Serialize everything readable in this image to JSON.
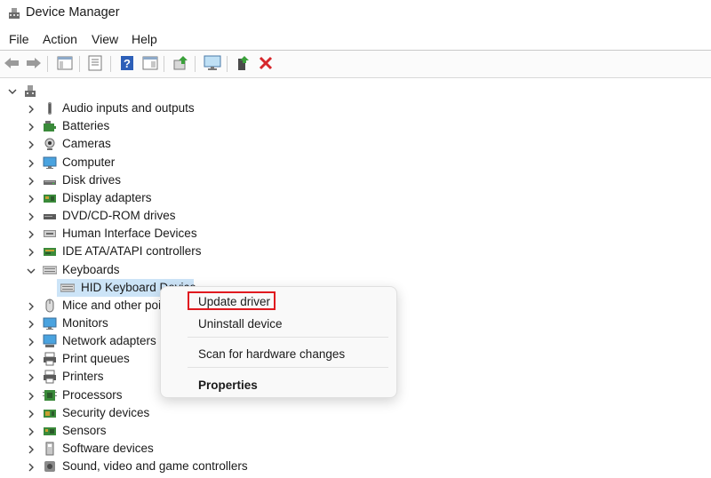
{
  "window": {
    "title": "Device Manager"
  },
  "menu": [
    "File",
    "Action",
    "View",
    "Help"
  ],
  "toolbar": [
    "back-icon",
    "forward-icon",
    "show-hide-console-tree-icon",
    "properties-icon",
    "help-icon",
    "view-icon",
    "update-driver-icon",
    "scan-hardware-icon",
    "enable-device-icon",
    "uninstall-device-icon"
  ],
  "tree": {
    "root": {
      "expanded": true
    },
    "categories": [
      {
        "label": "Audio inputs and outputs",
        "icon": "speaker-icon",
        "expanded": false
      },
      {
        "label": "Batteries",
        "icon": "battery-icon",
        "expanded": false
      },
      {
        "label": "Cameras",
        "icon": "camera-icon",
        "expanded": false
      },
      {
        "label": "Computer",
        "icon": "computer-icon",
        "expanded": false
      },
      {
        "label": "Disk drives",
        "icon": "disk-drive-icon",
        "expanded": false
      },
      {
        "label": "Display adapters",
        "icon": "display-adapter-icon",
        "expanded": false
      },
      {
        "label": "DVD/CD-ROM drives",
        "icon": "dvd-drive-icon",
        "expanded": false
      },
      {
        "label": "Human Interface Devices",
        "icon": "hid-icon",
        "expanded": false
      },
      {
        "label": "IDE ATA/ATAPI controllers",
        "icon": "ide-controller-icon",
        "expanded": false
      },
      {
        "label": "Keyboards",
        "icon": "keyboard-icon",
        "expanded": true
      },
      {
        "label": "HID Keyboard Device",
        "icon": "keyboard-icon",
        "child": true,
        "selected": true
      },
      {
        "label": "Mice and other pointing devices",
        "icon": "mouse-icon",
        "expanded": false
      },
      {
        "label": "Monitors",
        "icon": "monitor-icon",
        "expanded": false
      },
      {
        "label": "Network adapters",
        "icon": "network-adapter-icon",
        "expanded": false
      },
      {
        "label": "Print queues",
        "icon": "print-queue-icon",
        "expanded": false
      },
      {
        "label": "Printers",
        "icon": "printer-icon",
        "expanded": false
      },
      {
        "label": "Processors",
        "icon": "processor-icon",
        "expanded": false
      },
      {
        "label": "Security devices",
        "icon": "security-device-icon",
        "expanded": false
      },
      {
        "label": "Sensors",
        "icon": "sensor-icon",
        "expanded": false
      },
      {
        "label": "Software devices",
        "icon": "software-device-icon",
        "expanded": false
      },
      {
        "label": "Sound, video and game controllers",
        "icon": "sound-controller-icon",
        "expanded": false
      }
    ]
  },
  "context_menu": {
    "update_driver": "Update driver",
    "uninstall_device": "Uninstall device",
    "scan_hardware": "Scan for hardware changes",
    "properties": "Properties"
  },
  "colors": {
    "selection": "#cce4f7",
    "highlight_box": "#e0191f",
    "delete_red": "#d6262b"
  }
}
